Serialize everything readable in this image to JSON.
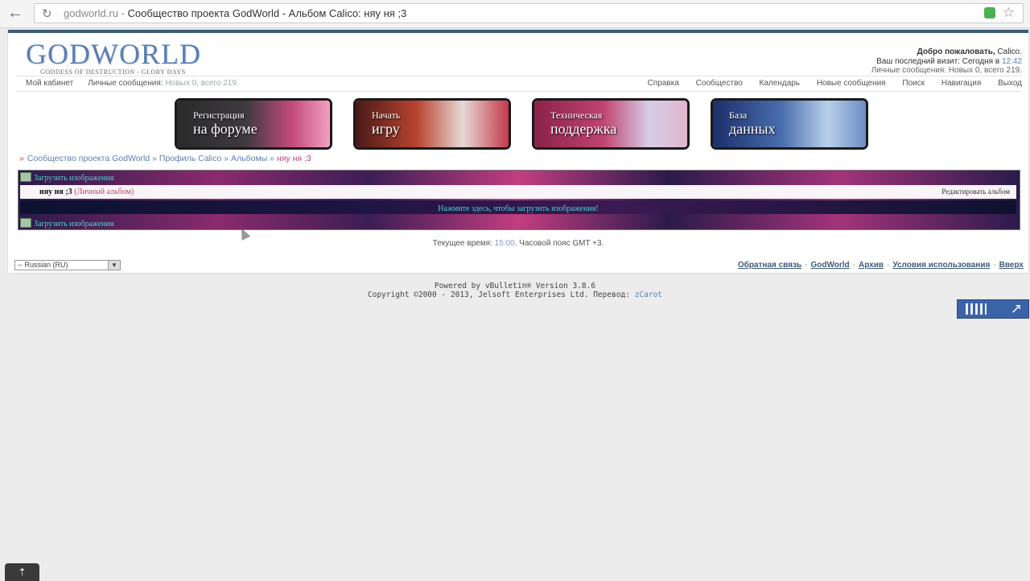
{
  "browser": {
    "domain": "godworld.ru",
    "separator": " - ",
    "tab_title": "Сообщество проекта GodWorld - Альбом Calico: няу ня ;3"
  },
  "site": {
    "logo_text": "GODWORLD",
    "logo_subtitle": "GODDESS OF DESTRUCTION - GLORY DAYS"
  },
  "welcome": {
    "greeting": "Добро пожаловать,",
    "user": "Calico.",
    "last_visit_label": "Ваш последний визит: Сегодня в",
    "last_visit_time": "12:42",
    "pm_line": "Личные сообщения: Новых 0, всего 219."
  },
  "navbar": {
    "left": [
      {
        "label": "Мой кабинет"
      },
      {
        "label": "Личные сообщения:"
      },
      {
        "label": "Новых 0, всего 219."
      }
    ],
    "right": [
      {
        "label": "Справка"
      },
      {
        "label": "Сообщество"
      },
      {
        "label": "Календарь"
      },
      {
        "label": "Новые сообщения"
      },
      {
        "label": "Поиск"
      },
      {
        "label": "Навигация"
      },
      {
        "label": "Выход"
      }
    ]
  },
  "banners": [
    {
      "line1": "Регистрация",
      "line2": "на форуме"
    },
    {
      "line1": "Начать",
      "line2": "игру"
    },
    {
      "line1": "Техническая",
      "line2": "поддержка"
    },
    {
      "line1": "База",
      "line2": "данных"
    }
  ],
  "breadcrumb": {
    "items": [
      "Сообщество проекта GodWorld",
      "Профиль Calico",
      "Альбомы"
    ],
    "separator": "»",
    "current": "няу ня ;3"
  },
  "album": {
    "upload_label": "Загрузить изображения",
    "name": "няу ня ;3",
    "type": "(Личный альбом)",
    "edit_label": "Редактировать альбом",
    "upload_prompt": "Нажмите здесь, чтобы загрузить изображения!"
  },
  "time": {
    "label": "Текущее время:",
    "value": "15:00",
    "tz": ". Часовой пояс GMT +3."
  },
  "footer": {
    "language": "-- Russian (RU)",
    "links": [
      "Обратная связь",
      "GodWorld",
      "Архив",
      "Условия использования",
      "Вверх"
    ]
  },
  "copyright": {
    "powered": "Powered by vBulletin® Version 3.8.6",
    "copy": "Copyright ©2000 - 2013, Jelsoft Enterprises Ltd. Перевод:",
    "translator": "zCarot"
  },
  "colors": {
    "accent": "#3e5c78",
    "link_blue": "#5b7fb5",
    "highlight_pink": "#c0446a",
    "cyan_text": "#4fd0cc"
  }
}
